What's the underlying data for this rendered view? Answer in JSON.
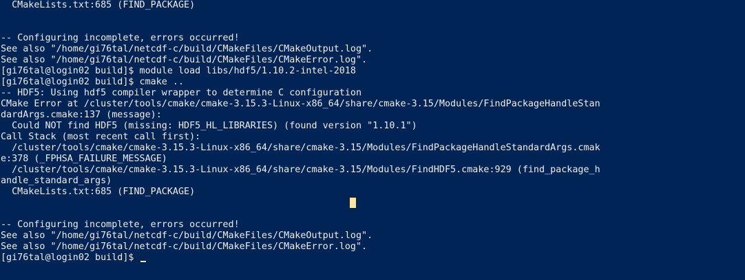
{
  "terminal": {
    "lines": [
      "  CMakeLists.txt:685 (FIND_PACKAGE)",
      "",
      "",
      "-- Configuring incomplete, errors occurred!",
      "See also \"/home/gi76tal/netcdf-c/build/CMakeFiles/CMakeOutput.log\".",
      "See also \"/home/gi76tal/netcdf-c/build/CMakeFiles/CMakeError.log\".",
      "[gi76tal@login02 build]$ module load libs/hdf5/1.10.2-intel-2018",
      "[gi76tal@login02 build]$ cmake ..",
      "-- HDF5: Using hdf5 compiler wrapper to determine C configuration",
      "CMake Error at /cluster/tools/cmake/cmake-3.15.3-Linux-x86_64/share/cmake-3.15/Modules/FindPackageHandleStan",
      "dardArgs.cmake:137 (message):",
      "  Could NOT find HDF5 (missing: HDF5_HL_LIBRARIES) (found version \"1.10.1\")",
      "Call Stack (most recent call first):",
      "  /cluster/tools/cmake/cmake-3.15.3-Linux-x86_64/share/cmake-3.15/Modules/FindPackageHandleStandardArgs.cmak",
      "e:378 (_FPHSA_FAILURE_MESSAGE)",
      "  /cluster/tools/cmake/cmake-3.15.3-Linux-x86_64/share/cmake-3.15/Modules/FindHDF5.cmake:929 (find_package_h",
      "andle_standard_args)",
      "  CMakeLists.txt:685 (FIND_PACKAGE)",
      "",
      "",
      "-- Configuring incomplete, errors occurred!",
      "See also \"/home/gi76tal/netcdf-c/build/CMakeFiles/CMakeOutput.log\".",
      "See also \"/home/gi76tal/netcdf-c/build/CMakeFiles/CMakeError.log\"."
    ],
    "prompt": "[gi76tal@login02 build]$ ",
    "colors": {
      "background": "#012456",
      "foreground": "#EEEDF0",
      "cursor": "#FEE4A6"
    }
  }
}
